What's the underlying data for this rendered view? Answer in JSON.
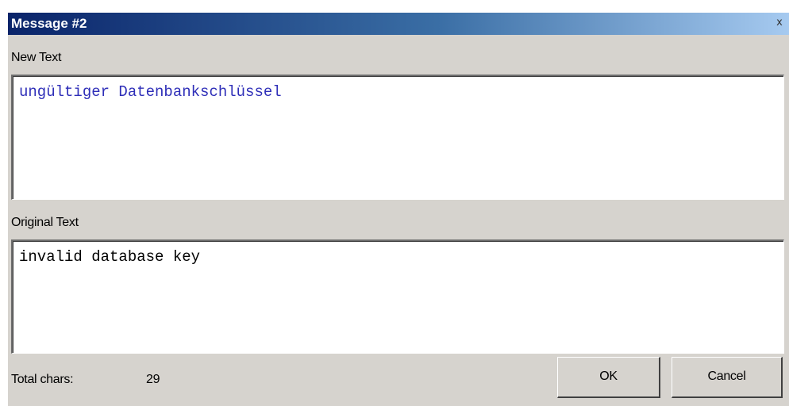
{
  "window": {
    "title": "Message #2",
    "close_glyph": "x"
  },
  "new_text": {
    "label": "New Text",
    "value": "ungültiger Datenbankschlüssel",
    "text_color": "#2e2eb8"
  },
  "original_text": {
    "label": "Original Text",
    "value": "invalid database key"
  },
  "footer": {
    "total_label": "Total chars:",
    "total_value": "29",
    "ok_label": "OK",
    "cancel_label": "Cancel"
  },
  "colors": {
    "titlebar_start": "#0a246a",
    "titlebar_end": "#a6caf0",
    "dialog_background": "#d6d3ce"
  }
}
